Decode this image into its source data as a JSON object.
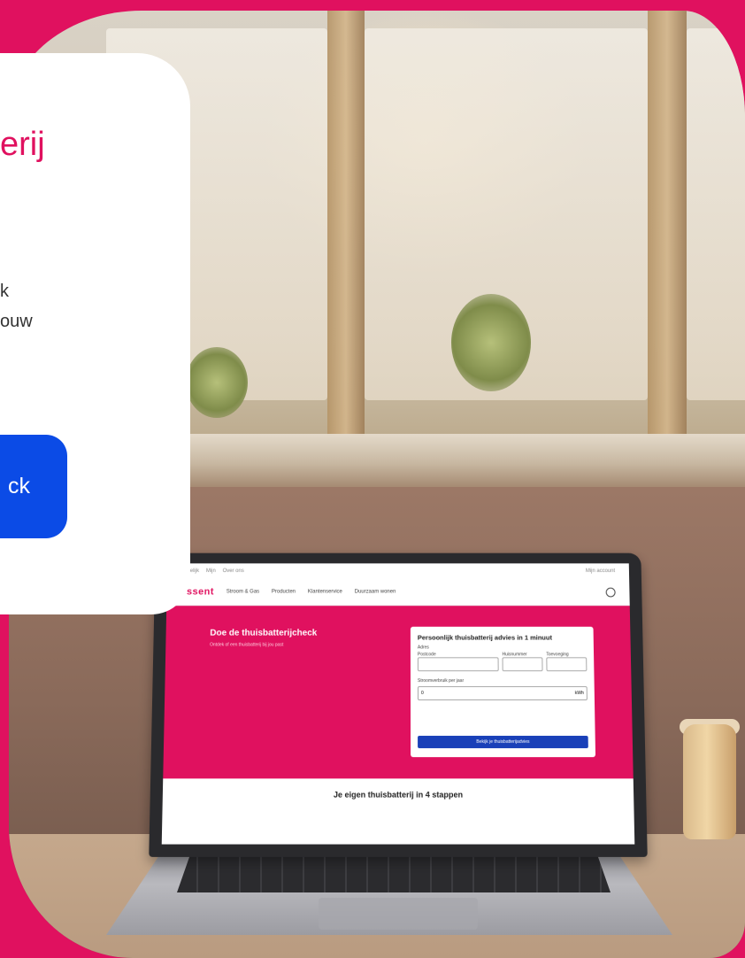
{
  "colors": {
    "brand_magenta": "#e0115f",
    "cta_blue": "#0b4be6",
    "card_white": "#ffffff"
  },
  "card": {
    "title_visible": "erij",
    "body_lines_visible": [
      "k",
      "ouw"
    ],
    "cta_visible": "ck"
  },
  "laptop_screen": {
    "top_links": [
      "Zakelijk",
      "Mijn",
      "Over ons"
    ],
    "top_right": "Mijn account",
    "logo": "essent",
    "nav_items": [
      "Stroom & Gas",
      "Producten",
      "Klantenservice",
      "Duurzaam wonen"
    ],
    "search_icon": "search-icon",
    "hero_title": "Doe de thuisbatterijcheck",
    "hero_subtitle": "Ontdek of een thuisbatterij bij jou past",
    "form": {
      "title": "Persoonlijk thuisbatterij advies in 1 minuut",
      "address_label": "Adres",
      "postcode_label": "Postcode",
      "housenumber_label": "Huisnummer",
      "addition_label": "Toevoeging",
      "usage_label": "Stroomverbruik per jaar",
      "usage_value": "0",
      "usage_unit": "kWh",
      "submit_label": "Bekijk je thuisbatterijadvies"
    },
    "bottom_heading": "Je eigen thuisbatterij in 4 stappen"
  }
}
